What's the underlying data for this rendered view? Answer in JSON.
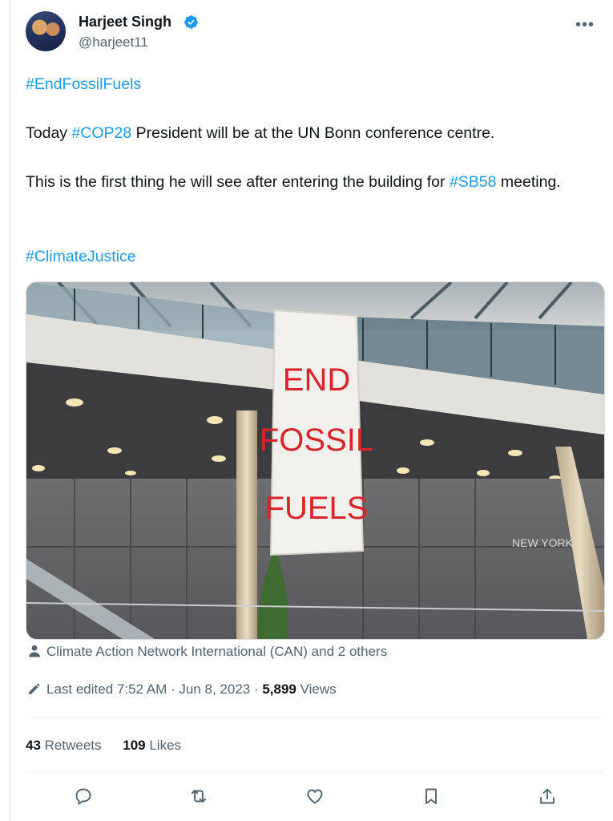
{
  "author": {
    "name": "Harjeet Singh",
    "handle": "@harjeet11",
    "verified": true
  },
  "menu_icon": "more-horizontal-icon",
  "tweet": {
    "hashtag_top": "#EndFossilFuels",
    "line1_prefix": "Today ",
    "line1_hashtag": "#COP28",
    "line1_suffix": " President will be at the UN Bonn conference centre.",
    "line2_prefix": "This is the first thing he will see after entering the building for ",
    "line2_hashtag": "#SB58",
    "line2_suffix": " meeting.",
    "hashtag_bottom": "#ClimateJustice"
  },
  "photo": {
    "banner_line1": "END",
    "banner_line2": "FOSSIL",
    "banner_line3": "FUELS",
    "wall_sign": "NEW YORK"
  },
  "tagged": {
    "icon": "person-icon",
    "text": "Climate Action Network International (CAN) and 2 others"
  },
  "meta": {
    "icon": "pencil-icon",
    "edited_text": "Last edited 7:52 AM · Jun 8, 2023 · ",
    "views_count": "5,899",
    "views_label": " Views"
  },
  "stats": {
    "retweets_count": "43",
    "retweets_label": " Retweets",
    "likes_count": "109",
    "likes_label": " Likes"
  },
  "colors": {
    "link": "#1d9bf0",
    "secondary_text": "#536471",
    "primary_text": "#0f1419",
    "banner_ink": "#d9242b"
  }
}
